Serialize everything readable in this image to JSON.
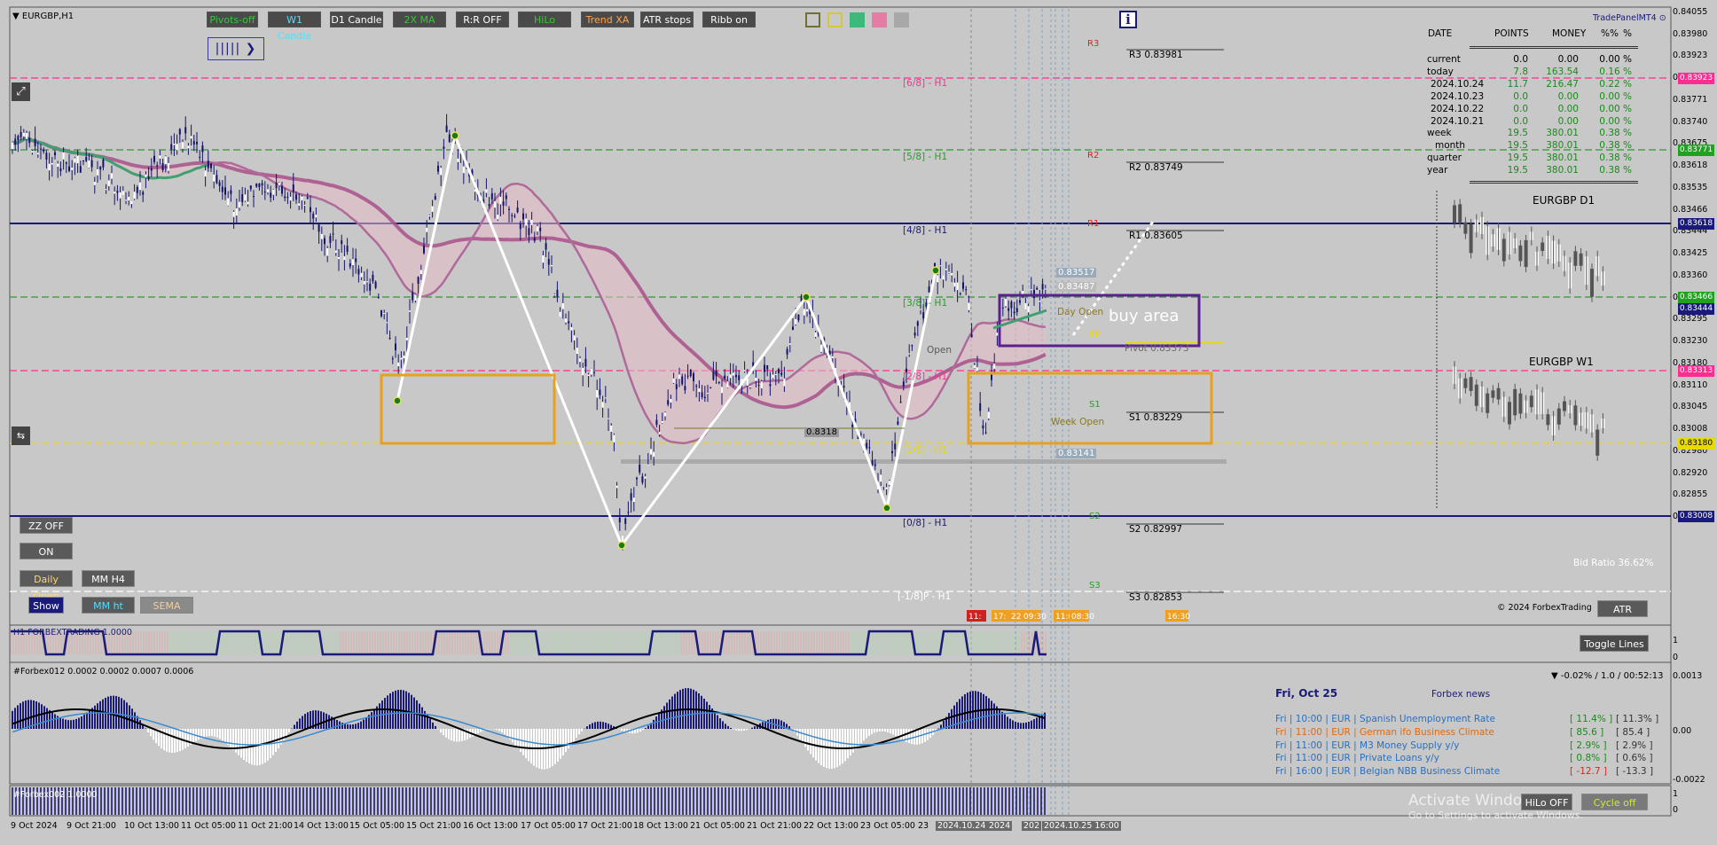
{
  "window": {
    "symbol": "EURGBP,H1",
    "brand": "TradePanelMT4",
    "copyright": "© 2024 ForbexTrading"
  },
  "toolbar": {
    "buttons": [
      "Pivots-off",
      "W1 Candle",
      "D1 Candle",
      "2X MA",
      "R:R OFF",
      "HiLo",
      "Trend XA",
      "ATR stops",
      "Ribb on"
    ]
  },
  "info_icon": "i",
  "stats": {
    "headers": [
      "DATE",
      "POINTS",
      "MONEY",
      "%%",
      "%"
    ],
    "rows": [
      {
        "label": "current",
        "points": "0.0",
        "money": "0.00",
        "pct": "0.00 %"
      },
      {
        "label": "today",
        "points": "7.8",
        "money": "163.54",
        "pct": "0.16 %"
      },
      {
        "label": "2024.10.24",
        "points": "11.7",
        "money": "216.47",
        "pct": "0.22 %"
      },
      {
        "label": "2024.10.23",
        "points": "0.0",
        "money": "0.00",
        "pct": "0.00 %"
      },
      {
        "label": "2024.10.22",
        "points": "0.0",
        "money": "0.00",
        "pct": "0.00 %"
      },
      {
        "label": "2024.10.21",
        "points": "0.0",
        "money": "0.00",
        "pct": "0.00 %"
      },
      {
        "label": "week",
        "points": "19.5",
        "money": "380.01",
        "pct": "0.38 %"
      },
      {
        "label": "month",
        "points": "19.5",
        "money": "380.01",
        "pct": "0.38 %"
      },
      {
        "label": "quarter",
        "points": "19.5",
        "money": "380.01",
        "pct": "0.38 %"
      },
      {
        "label": "year",
        "points": "19.5",
        "money": "380.01",
        "pct": "0.38 %"
      }
    ]
  },
  "mini_charts": {
    "d1_title": "EURGBP D1",
    "w1_title": "EURGBP W1",
    "bid_ratio": "Bid Ratio 36.62%"
  },
  "murrey": [
    "[6/8] - H1",
    "[5/8] - H1",
    "[4/8] - H1",
    "[3/8] - H1",
    "[2/8] - H1",
    "[1/8] - H1",
    "[0/8] - H1",
    "[-1/8]P - H1"
  ],
  "pivots": {
    "R3": "R3 0.83981",
    "R2": "R2 0.83749",
    "R1": "R1 0.83605",
    "Pivot": "Pivot 0.83373",
    "S1": "S1 0.83229",
    "S2": "S2 0.82997",
    "S3": "S3 0.82853"
  },
  "pivot_tags": {
    "r3": "R3",
    "r2": "R2",
    "r1": "R1",
    "s1": "S1",
    "s2": "S2",
    "s3": "S3",
    "pp": "PP"
  },
  "annotations": {
    "buy_area": "buy area",
    "week_open": "Week Open",
    "day_open": "Day Open",
    "open": "Open",
    "price1": "0.83517",
    "price2": "0.83487",
    "price3": "0.83141",
    "price4": "0.8318"
  },
  "price_axis": [
    "0.84055",
    "0.83980",
    "0.83923",
    "0.83845",
    "0.83771",
    "0.83740",
    "0.83675",
    "0.83618",
    "0.83535",
    "0.83466",
    "0.83444",
    "0.83425",
    "0.83360",
    "0.83313",
    "0.83295",
    "0.83230",
    "0.83180",
    "0.83110",
    "0.83045",
    "0.83008",
    "0.82980",
    "0.82920",
    "0.82855",
    "0.82795"
  ],
  "price_highlight": [
    {
      "v": "0.83923",
      "c": "#ff2d8f"
    },
    {
      "v": "0.83771",
      "c": "#1fa31f"
    },
    {
      "v": "0.83618",
      "c": "#1a1a7a"
    },
    {
      "v": "0.83466",
      "c": "#1fa31f"
    },
    {
      "v": "0.83444",
      "c": "#1a1a7a"
    },
    {
      "v": "0.83313",
      "c": "#ff2d8f"
    },
    {
      "v": "0.83180",
      "c": "#e8d900"
    },
    {
      "v": "0.83008",
      "c": "#1a1a7a"
    }
  ],
  "time_axis": [
    "9 Oct 2024",
    "9 Oct 21:00",
    "10 Oct 13:00",
    "11 Oct 05:00",
    "11 Oct 21:00",
    "14 Oct 13:00",
    "15 Oct 05:00",
    "15 Oct 21:00",
    "16 Oct 13:00",
    "17 Oct 05:00",
    "17 Oct 21:00",
    "18 Oct 13:00",
    "21 Oct 05:00",
    "21 Oct 21:00",
    "22 Oct 13:00",
    "23 Oct 05:00",
    "23",
    "2024.10.24 11:",
    "2024",
    "202",
    "2024.10.25 16:00"
  ],
  "left_buttons": {
    "zz": "ZZ OFF",
    "on": "ON",
    "daily_open": "Daily Open",
    "mm_h4": "MM H4",
    "show": "Show",
    "mm_ht": "MM ht",
    "sema": "SEMA"
  },
  "right_buttons": {
    "atr": "ATR",
    "toggle_lines": "Toggle Lines",
    "hilo_off": "HiLo OFF",
    "cycle_off": "Cycle off"
  },
  "indicator1": {
    "label": "H1 FORBEXTRADING 1.0000",
    "scale": [
      "1",
      "0"
    ]
  },
  "indicator2": {
    "label": "#Forbex012 0.0002 0.0002 0.0007 0.0006",
    "scale": [
      "0.0013",
      "0.00",
      "-0.0022"
    ],
    "header": "▼ -0.02% / 1.0 / 00:52:13"
  },
  "indicator3": {
    "label": "#Forbex002 1.0000",
    "scale": [
      "1",
      "0"
    ]
  },
  "news": {
    "date": "Fri, Oct 25",
    "source": "Forbex news",
    "items": [
      {
        "text": "Fri  |  10:00  |  EUR  |  Spanish Unemployment Rate",
        "v1": "[ 11.4% ]",
        "v2": "[ 11.3% ]",
        "color": "#2a6fbf"
      },
      {
        "text": "Fri  |  11:00  |  EUR  |  German ifo Business Climate",
        "v1": "[ 85.6 ]",
        "v2": "[ 85.4 ]",
        "color": "#e06a10"
      },
      {
        "text": "Fri  |  11:00  |  EUR  |  M3 Money Supply y/y",
        "v1": "[ 2.9% ]",
        "v2": "[ 2.9% ]",
        "color": "#2a6fbf"
      },
      {
        "text": "Fri  |  11:00  |  EUR  |  Private Loans y/y",
        "v1": "[ 0.8% ]",
        "v2": "[ 0.6% ]",
        "color": "#2a6fbf"
      },
      {
        "text": "Fri  |  16:00  |  EUR  |  Belgian NBB Business Climate",
        "v1": "[ -12.7 ]",
        "v2": "[ -13.3 ]",
        "color": "#2a6fbf"
      }
    ]
  },
  "watermark": {
    "line1": "Activate Windows",
    "line2": "Go to Settings to activate Windows."
  },
  "session_tags": [
    "11:",
    "17:",
    "22:",
    "09:30",
    "11:00",
    "08:30",
    "16:30"
  ]
}
